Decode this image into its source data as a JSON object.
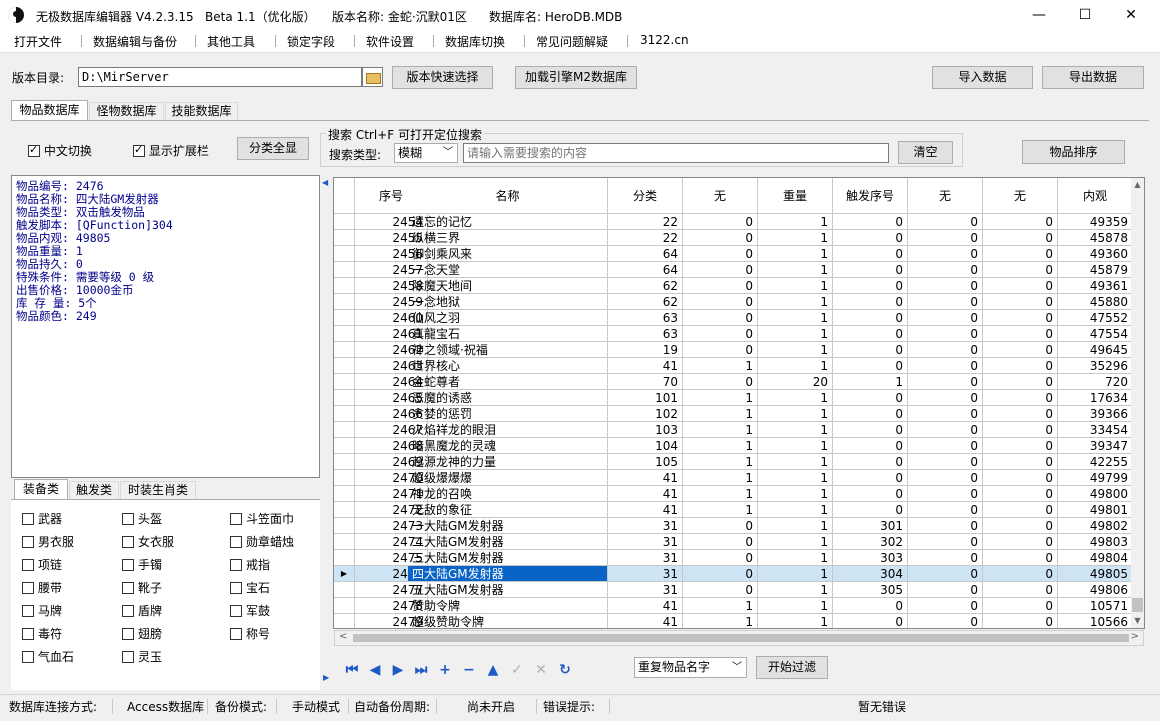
{
  "titlebar": {
    "app_name": "无极数据库编辑器 V4.2.3.15",
    "beta": "Beta 1.1（优化版）",
    "version_name": "版本名称: 金蛇·沉默01区",
    "db_name": "数据库名: HeroDB.MDB",
    "minimize": "—",
    "maximize": "☐",
    "close": "✕"
  },
  "menu": [
    "打开文件",
    "数据编辑与备份",
    "其他工具",
    "锁定字段",
    "软件设置",
    "数据库切换",
    "常见问题解疑",
    "3122.cn"
  ],
  "toolbar": {
    "dir_label": "版本目录:",
    "dir_value": "D:\\MirServer",
    "quick_select": "版本快速选择",
    "load_engine": "加载引擎M2数据库",
    "import": "导入数据",
    "export": "导出数据"
  },
  "tabs": [
    "物品数据库",
    "怪物数据库",
    "技能数据库"
  ],
  "options": {
    "chinese_toggle": "中文切换",
    "show_ext": "显示扩展栏",
    "show_all": "分类全显"
  },
  "search": {
    "group_title": "搜索  Ctrl+F 可打开定位搜索",
    "type_label": "搜索类型:",
    "type_value": "模糊",
    "placeholder": "请输入需要搜索的内容",
    "clear": "清空",
    "sort": "物品排序"
  },
  "info": {
    "lines": [
      "物品编号: 2476",
      "物品名称: 四大陆GM发射器",
      "物品类型: 双击触发物品",
      "触发脚本: [QFunction]304",
      "物品内观: 49805",
      "物品重量: 1",
      "物品持久: 0",
      "特殊条件: 需要等级 0 级",
      "出售价格: 10000金币",
      "库 存 量: 5个",
      "物品颜色: 249"
    ]
  },
  "category_tabs": [
    "装备类",
    "触发类",
    "时装生肖类"
  ],
  "categories": [
    [
      "武器",
      "头盔",
      "斗笠面巾"
    ],
    [
      "男衣服",
      "女衣服",
      "勋章蜡烛"
    ],
    [
      "项链",
      "手镯",
      "戒指"
    ],
    [
      "腰带",
      "靴子",
      "宝石"
    ],
    [
      "马牌",
      "盾牌",
      "军鼓"
    ],
    [
      "毒符",
      "翅膀",
      "称号"
    ],
    [
      "气血石",
      "灵玉",
      ""
    ]
  ],
  "grid": {
    "headers": [
      "序号",
      "名称",
      "分类",
      "无",
      "重量",
      "触发序号",
      "无",
      "无",
      "内观"
    ],
    "rows": [
      [
        "2454",
        "遗忘的记忆",
        "22",
        "0",
        "1",
        "0",
        "0",
        "0",
        "49359"
      ],
      [
        "2455",
        "纵横三界",
        "22",
        "0",
        "1",
        "0",
        "0",
        "0",
        "45878"
      ],
      [
        "2456",
        "御剑乘风来",
        "64",
        "0",
        "1",
        "0",
        "0",
        "0",
        "49360"
      ],
      [
        "2457",
        "一念天堂",
        "64",
        "0",
        "1",
        "0",
        "0",
        "0",
        "45879"
      ],
      [
        "2458",
        "除魔天地间",
        "62",
        "0",
        "1",
        "0",
        "0",
        "0",
        "49361"
      ],
      [
        "2459",
        "一念地狱",
        "62",
        "0",
        "1",
        "0",
        "0",
        "0",
        "45880"
      ],
      [
        "2460",
        "仙风之羽",
        "63",
        "0",
        "1",
        "0",
        "0",
        "0",
        "47552"
      ],
      [
        "2461",
        "真龍宝石",
        "63",
        "0",
        "1",
        "0",
        "0",
        "0",
        "47554"
      ],
      [
        "2462",
        "神之领域·祝福",
        "19",
        "0",
        "1",
        "0",
        "0",
        "0",
        "49645"
      ],
      [
        "2463",
        "世界核心",
        "41",
        "1",
        "1",
        "0",
        "0",
        "0",
        "35296"
      ],
      [
        "2464",
        "金蛇尊者",
        "70",
        "0",
        "20",
        "1",
        "0",
        "0",
        "720"
      ],
      [
        "2465",
        "恶魔的诱惑",
        "101",
        "1",
        "1",
        "0",
        "0",
        "0",
        "17634"
      ],
      [
        "2466",
        "贪婪的惩罚",
        "102",
        "1",
        "1",
        "0",
        "0",
        "0",
        "39366"
      ],
      [
        "2467",
        "火焰祥龙的眼泪",
        "103",
        "1",
        "1",
        "0",
        "0",
        "0",
        "33454"
      ],
      [
        "2468",
        "暗黑魔龙的灵魂",
        "104",
        "1",
        "1",
        "0",
        "0",
        "0",
        "39347"
      ],
      [
        "2469",
        "起源龙神的力量",
        "105",
        "1",
        "1",
        "0",
        "0",
        "0",
        "42255"
      ],
      [
        "2470",
        "超级爆爆爆",
        "41",
        "1",
        "1",
        "0",
        "0",
        "0",
        "49799"
      ],
      [
        "2471",
        "神龙的召唤",
        "41",
        "1",
        "1",
        "0",
        "0",
        "0",
        "49800"
      ],
      [
        "2472",
        "无敌的象征",
        "41",
        "1",
        "1",
        "0",
        "0",
        "0",
        "49801"
      ],
      [
        "2473",
        "一大陆GM发射器",
        "31",
        "0",
        "1",
        "301",
        "0",
        "0",
        "49802"
      ],
      [
        "2474",
        "二大陆GM发射器",
        "31",
        "0",
        "1",
        "302",
        "0",
        "0",
        "49803"
      ],
      [
        "2475",
        "三大陆GM发射器",
        "31",
        "0",
        "1",
        "303",
        "0",
        "0",
        "49804"
      ],
      [
        "2476",
        "四大陆GM发射器",
        "31",
        "0",
        "1",
        "304",
        "0",
        "0",
        "49805"
      ],
      [
        "2477",
        "五大陆GM发射器",
        "31",
        "0",
        "1",
        "305",
        "0",
        "0",
        "49806"
      ],
      [
        "2478",
        "赞助令牌",
        "41",
        "1",
        "1",
        "0",
        "0",
        "0",
        "10571"
      ],
      [
        "2479",
        "超级赞助令牌",
        "41",
        "1",
        "1",
        "0",
        "0",
        "0",
        "10566"
      ]
    ],
    "selected_row": "2476",
    "row_pointer": "▶"
  },
  "bottom": {
    "filter_value": "重复物品名字",
    "start_filter": "开始过滤"
  },
  "status": {
    "conn_label": "数据库连接方式:",
    "conn_value": "Access数据库",
    "backup_label": "备份模式:",
    "backup_value": "手动模式",
    "auto_label": "自动备份周期:",
    "auto_value": "尚未开启",
    "err_label": "错误提示:",
    "err_value": "暂无错误"
  }
}
